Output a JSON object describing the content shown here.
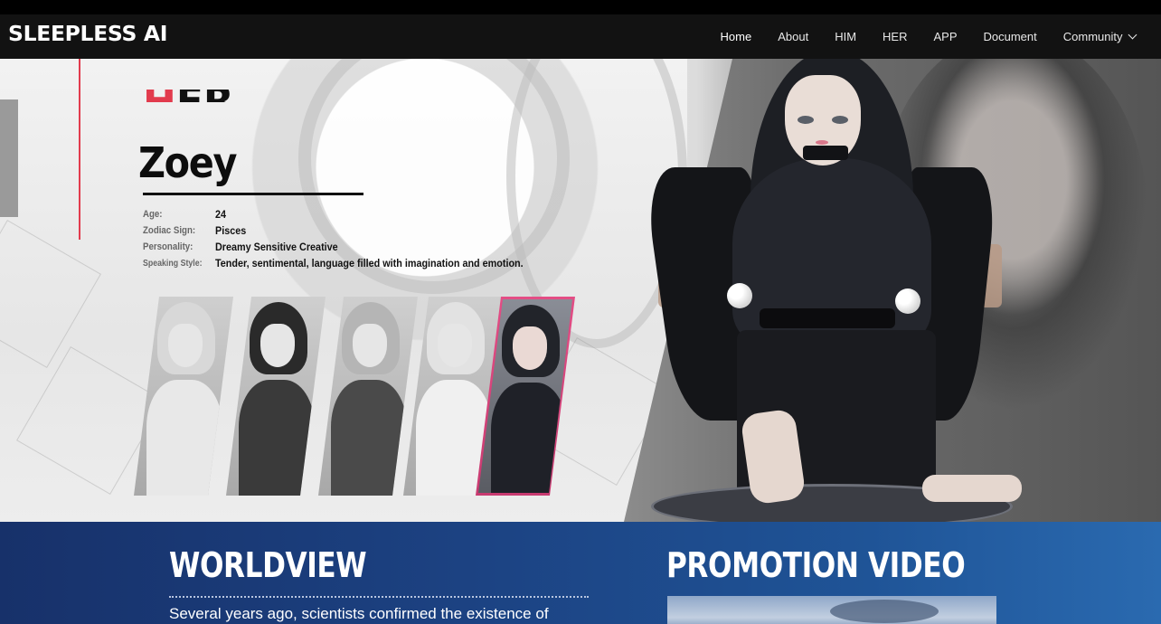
{
  "brand": {
    "logo_text": "SLEEPLESS AI"
  },
  "nav": {
    "items": [
      {
        "label": "Home",
        "active": true
      },
      {
        "label": "About"
      },
      {
        "label": "HIM"
      },
      {
        "label": "HER"
      },
      {
        "label": "APP"
      },
      {
        "label": "Document"
      },
      {
        "label": "Community",
        "has_dropdown": true
      }
    ]
  },
  "profile": {
    "section_heading": "HER",
    "name": "Zoey",
    "attributes": [
      {
        "label": "Age:",
        "value": "24"
      },
      {
        "label": "Zodiac Sign:",
        "value": "Pisces"
      },
      {
        "label": "Personality:",
        "value": "Dreamy Sensitive Creative"
      },
      {
        "label": "Speaking Style:",
        "value": "Tender, sentimental, language filled with imagination and emotion."
      }
    ]
  },
  "character_selector": {
    "selected_index": 4,
    "count": 5
  },
  "worldview": {
    "title": "WORLDVIEW",
    "text": "Several years ago, scientists confirmed the existence of"
  },
  "promotion": {
    "title": "PROMOTION VIDEO"
  },
  "colors": {
    "accent_red": "#e23b4d",
    "selected_pink": "#e34d85",
    "navbar_bg": "#121212",
    "section_blue": "#1c4282"
  }
}
